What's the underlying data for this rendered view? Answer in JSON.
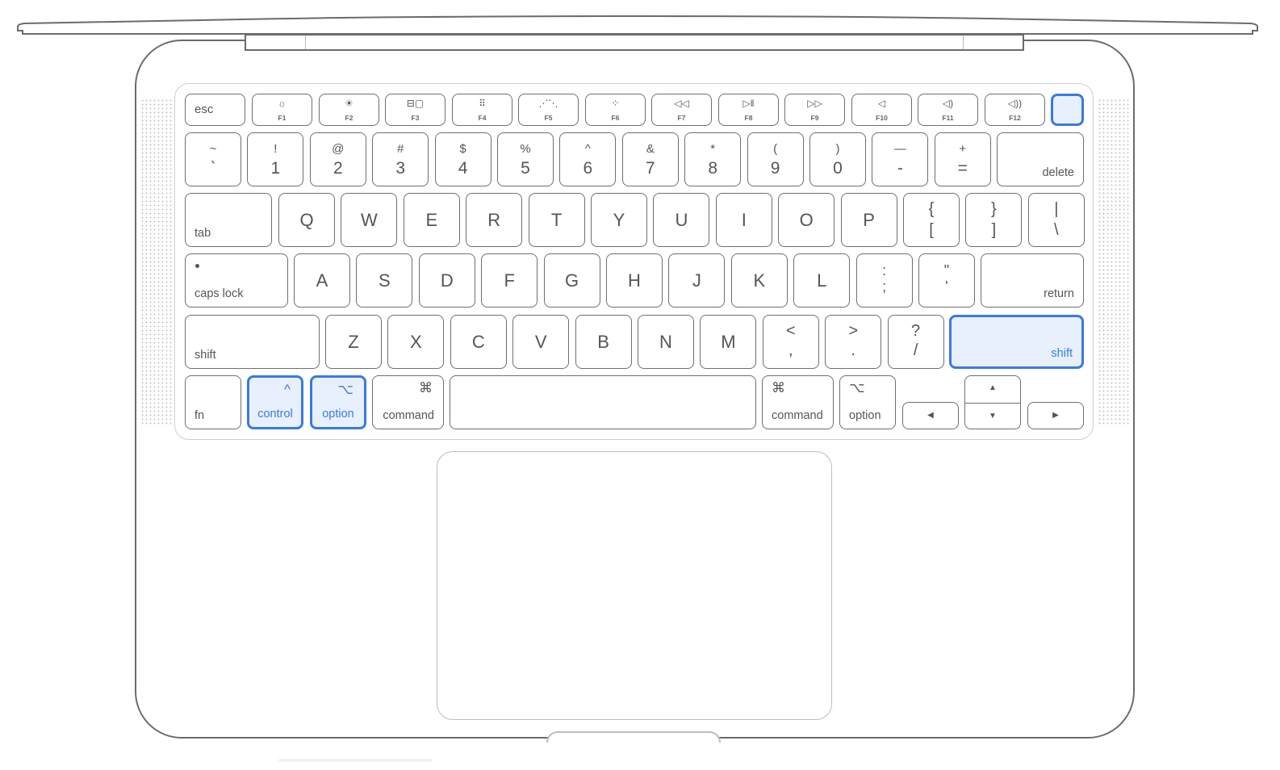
{
  "highlight_color": "#3a7ae0",
  "highlight_fill": "#e8f0fd",
  "function_row": [
    {
      "id": "esc",
      "label": "esc"
    },
    {
      "id": "f1",
      "icon": "brightness-down-icon",
      "glyph": "☼",
      "label": "F1"
    },
    {
      "id": "f2",
      "icon": "brightness-up-icon",
      "glyph": "☀",
      "label": "F2"
    },
    {
      "id": "f3",
      "icon": "mission-control-icon",
      "glyph": "⊟▢",
      "label": "F3"
    },
    {
      "id": "f4",
      "icon": "launchpad-icon",
      "glyph": "⠿",
      "label": "F4"
    },
    {
      "id": "f5",
      "icon": "keyboard-brightness-down-icon",
      "glyph": "⋰⋱",
      "label": "F5"
    },
    {
      "id": "f6",
      "icon": "keyboard-brightness-up-icon",
      "glyph": "⁘",
      "label": "F6"
    },
    {
      "id": "f7",
      "icon": "rewind-icon",
      "glyph": "◁◁",
      "label": "F7"
    },
    {
      "id": "f8",
      "icon": "play-pause-icon",
      "glyph": "▷ǁ",
      "label": "F8"
    },
    {
      "id": "f9",
      "icon": "fast-forward-icon",
      "glyph": "▷▷",
      "label": "F9"
    },
    {
      "id": "f10",
      "icon": "mute-icon",
      "glyph": "◁",
      "label": "F10"
    },
    {
      "id": "f11",
      "icon": "volume-down-icon",
      "glyph": "◁)",
      "label": "F11"
    },
    {
      "id": "f12",
      "icon": "volume-up-icon",
      "glyph": "◁))",
      "label": "F12"
    },
    {
      "id": "power",
      "label": "",
      "highlighted": true
    }
  ],
  "number_row": [
    {
      "top": "~",
      "bot": "`"
    },
    {
      "top": "!",
      "bot": "1"
    },
    {
      "top": "@",
      "bot": "2"
    },
    {
      "top": "#",
      "bot": "3"
    },
    {
      "top": "$",
      "bot": "4"
    },
    {
      "top": "%",
      "bot": "5"
    },
    {
      "top": "^",
      "bot": "6"
    },
    {
      "top": "&",
      "bot": "7"
    },
    {
      "top": "*",
      "bot": "8"
    },
    {
      "top": "(",
      "bot": "9"
    },
    {
      "top": ")",
      "bot": "0"
    },
    {
      "top": "—",
      "bot": "-"
    },
    {
      "top": "+",
      "bot": "="
    },
    {
      "label": "delete"
    }
  ],
  "qwerty_row": {
    "tab": "tab",
    "letters": [
      "Q",
      "W",
      "E",
      "R",
      "T",
      "Y",
      "U",
      "I",
      "O",
      "P"
    ],
    "symbols": [
      {
        "top": "{",
        "bot": "["
      },
      {
        "top": "}",
        "bot": "]"
      },
      {
        "top": "|",
        "bot": "\\"
      }
    ]
  },
  "home_row": {
    "caps": "caps lock",
    "letters": [
      "A",
      "S",
      "D",
      "F",
      "G",
      "H",
      "J",
      "K",
      "L"
    ],
    "symbols": [
      {
        "top": ":",
        "bot": ";"
      },
      {
        "top": "\"",
        "bot": "'"
      }
    ],
    "return": "return"
  },
  "shift_row": {
    "left_shift": "shift",
    "letters": [
      "Z",
      "X",
      "C",
      "V",
      "B",
      "N",
      "M"
    ],
    "symbols": [
      {
        "top": "<",
        "bot": ","
      },
      {
        "top": ">",
        "bot": "."
      },
      {
        "top": "?",
        "bot": "/"
      }
    ],
    "right_shift": "shift"
  },
  "bottom_row": {
    "fn": "fn",
    "control": {
      "label": "control",
      "glyph": "^",
      "highlighted": true
    },
    "option_left": {
      "label": "option",
      "glyph": "⌥",
      "highlighted": true
    },
    "command_left": {
      "label": "command",
      "glyph": "⌘"
    },
    "command_right": {
      "label": "command",
      "glyph": "⌘"
    },
    "option_right": {
      "label": "option",
      "glyph": "⌥"
    },
    "arrows": {
      "left": "◀",
      "up": "▲",
      "down": "▼",
      "right": "▶"
    }
  }
}
